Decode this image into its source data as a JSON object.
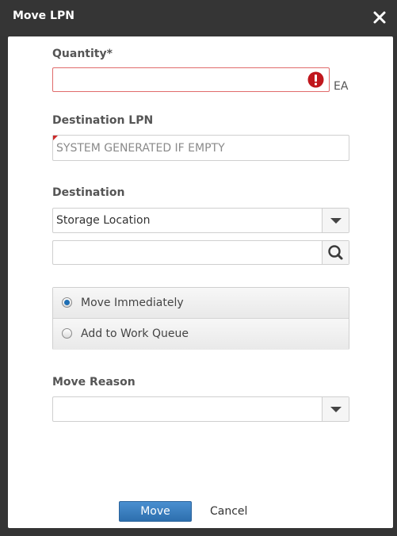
{
  "dialog": {
    "title": "Move LPN"
  },
  "quantity": {
    "label": "Quantity*",
    "value": "",
    "unit": "EA"
  },
  "destination_lpn": {
    "label": "Destination LPN",
    "placeholder": "SYSTEM GENERATED IF EMPTY"
  },
  "destination": {
    "label": "Destination",
    "selected": "Storage Location",
    "location_value": ""
  },
  "move_option": {
    "options": [
      {
        "label": "Move Immediately",
        "checked": true
      },
      {
        "label": "Add to Work Queue",
        "checked": false
      }
    ]
  },
  "move_reason": {
    "label": "Move Reason",
    "selected": ""
  },
  "footer": {
    "move_label": "Move",
    "cancel_label": "Cancel"
  },
  "colors": {
    "primary_button": "#2d6fae",
    "error": "#c0171d",
    "header_bg": "#353535"
  },
  "icons": {
    "close": "close-icon",
    "error": "error-icon",
    "dropdown": "chevron-down-icon",
    "search": "search-icon"
  }
}
